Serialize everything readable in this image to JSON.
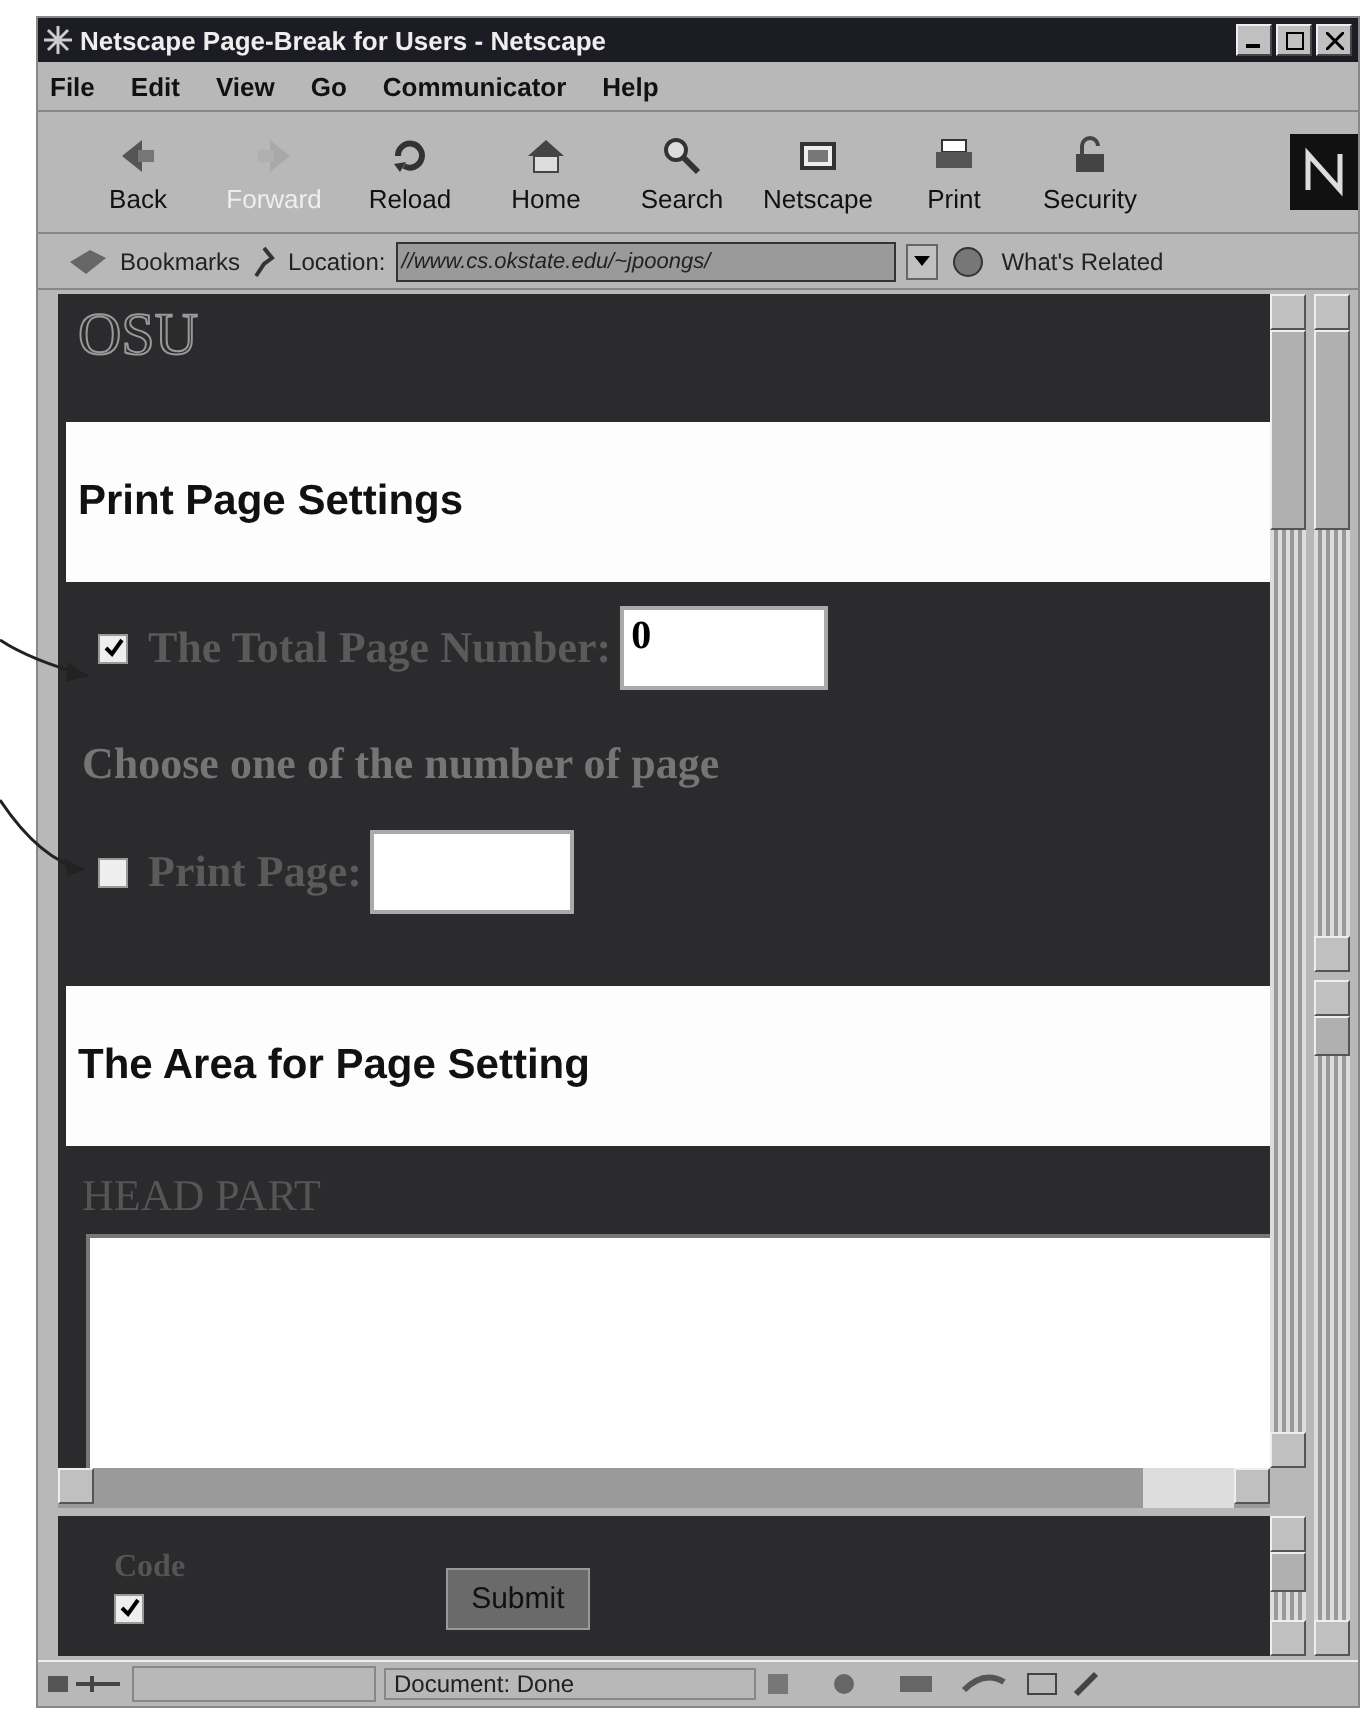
{
  "window": {
    "title": "Netscape Page-Break for Users - Netscape"
  },
  "menu": [
    "File",
    "Edit",
    "View",
    "Go",
    "Communicator",
    "Help"
  ],
  "toolbar": [
    {
      "label": "Back",
      "disabled": false
    },
    {
      "label": "Forward",
      "disabled": true
    },
    {
      "label": "Reload",
      "disabled": false
    },
    {
      "label": "Home",
      "disabled": false
    },
    {
      "label": "Search",
      "disabled": false
    },
    {
      "label": "Netscape",
      "disabled": false
    },
    {
      "label": "Print",
      "disabled": false
    },
    {
      "label": "Security",
      "disabled": false
    }
  ],
  "location": {
    "bookmarks": "Bookmarks",
    "label": "Location:",
    "value": "//www.cs.okstate.edu/~jpoongs/",
    "related": "What's Related"
  },
  "page": {
    "logo": "OSU",
    "heading_1": "Print Page Settings",
    "total": {
      "checked": true,
      "label": "The Total Page Number:",
      "value": "0"
    },
    "instruction": "Choose one of the number of page",
    "print_page": {
      "checked": false,
      "label": "Print Page:"
    },
    "heading_2": "The Area for Page Setting",
    "head_part": "HEAD PART"
  },
  "form": {
    "code_label": "Code",
    "code_checked": true,
    "submit": "Submit"
  },
  "status": "Document: Done"
}
